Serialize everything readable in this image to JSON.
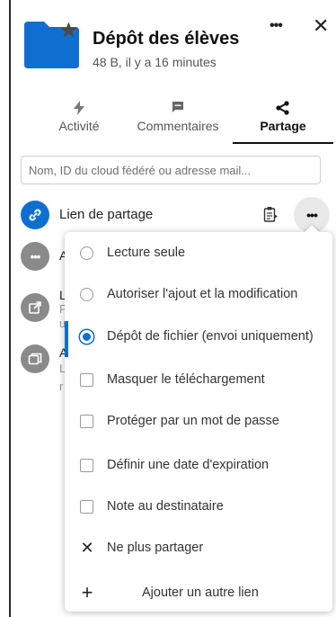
{
  "file": {
    "title": "Dépôt des élèves",
    "subtitle": "48 B, il y a 16 minutes",
    "icon": "folder-icon",
    "icon_color": "#0f6fd0"
  },
  "header": {
    "more_label": "•••",
    "close_label": "✕"
  },
  "tabs": [
    {
      "label": "Activité",
      "icon": "lightning-icon"
    },
    {
      "label": "Commentaires",
      "icon": "comment-icon"
    },
    {
      "label": "Partage",
      "icon": "share-icon",
      "active": true
    }
  ],
  "search": {
    "placeholder": "Nom, ID du cloud fédéré ou adresse mail..."
  },
  "share_link": {
    "label": "Lien de partage",
    "more_label": "•••",
    "more_left_label": "•••"
  },
  "peek": {
    "a1": "A",
    "l1": "L",
    "f1": "F",
    "u1": "u",
    "a2": "A",
    "l2": "L",
    "r2": "r"
  },
  "menu": {
    "items": [
      {
        "type": "radio",
        "label": "Lecture seule",
        "checked": false
      },
      {
        "type": "radio",
        "label": "Autoriser l'ajout et la modification",
        "checked": false
      },
      {
        "type": "radio",
        "label": "Dépôt de fichier (envoi uniquement)",
        "checked": true
      },
      {
        "type": "checkbox",
        "label": "Masquer le téléchargement",
        "checked": false
      },
      {
        "type": "checkbox",
        "label": "Protéger par un mot de passe",
        "checked": false
      },
      {
        "type": "checkbox",
        "label": "Définir une date d'expiration",
        "checked": false
      },
      {
        "type": "checkbox",
        "label": "Note au destinataire",
        "checked": false
      },
      {
        "type": "action",
        "label": "Ne plus partager",
        "icon": "close-icon",
        "symbol": "✕"
      },
      {
        "type": "action",
        "label": "Ajouter un autre lien",
        "icon": "plus-icon",
        "symbol": "+"
      }
    ]
  },
  "colors": {
    "accent": "#0f6fd0",
    "avatar_grey": "#8a8a8a"
  }
}
